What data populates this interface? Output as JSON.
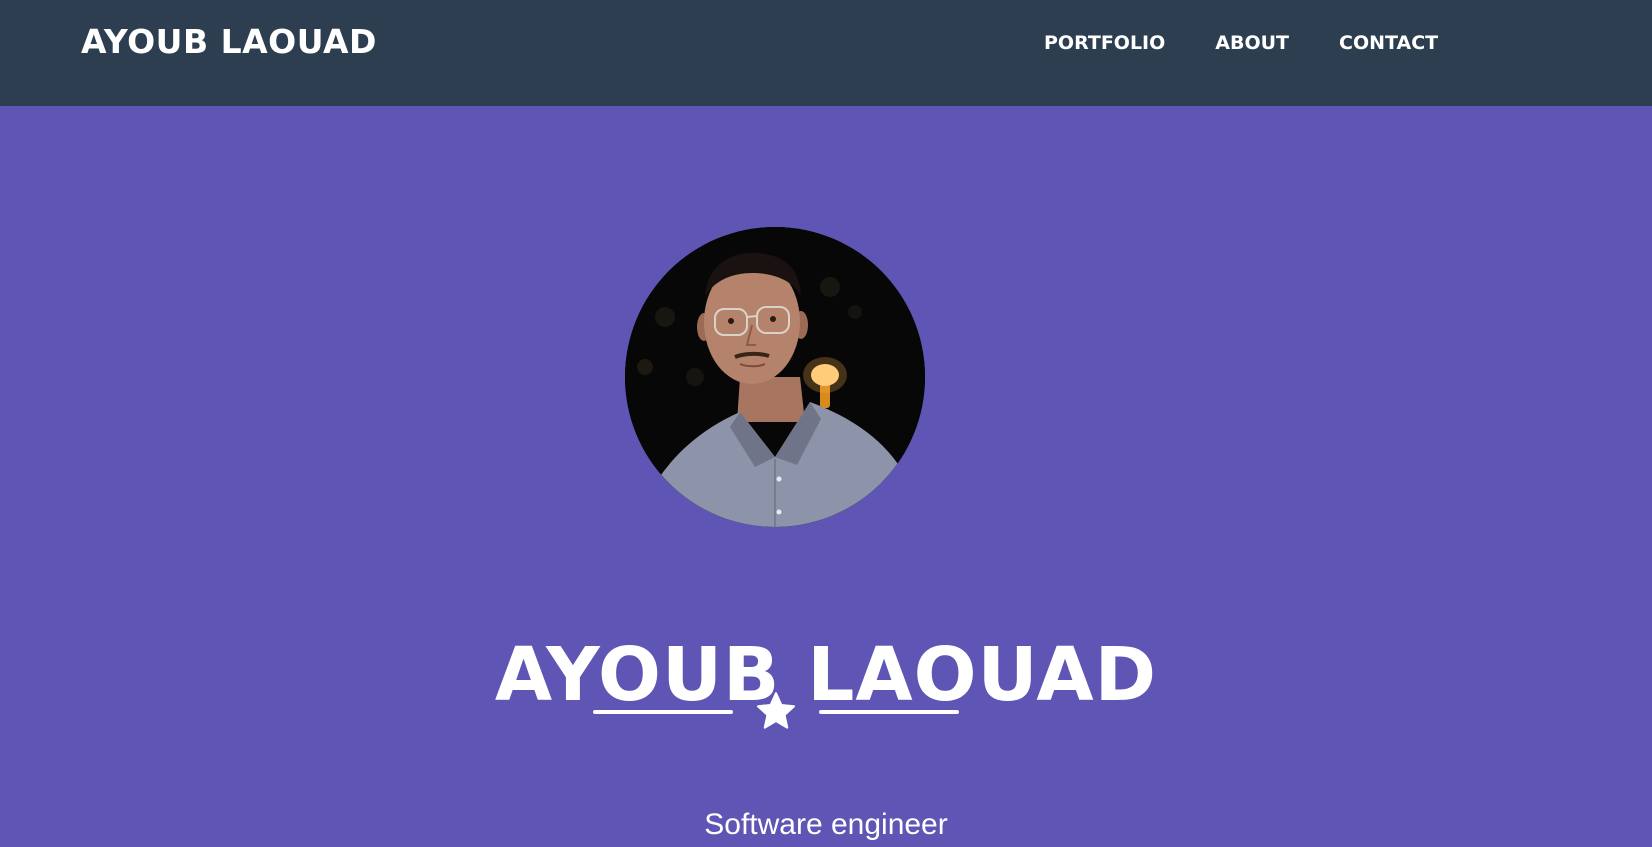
{
  "navbar": {
    "brand": "AYOUB LAOUAD",
    "links": [
      {
        "label": "PORTFOLIO"
      },
      {
        "label": "ABOUT"
      },
      {
        "label": "CONTACT"
      }
    ]
  },
  "hero": {
    "title": "AYOUB LAOUAD",
    "subtitle": "Software engineer",
    "divider_icon": "star-icon",
    "avatar_alt": "profile photo"
  },
  "colors": {
    "navbar_bg": "#2d3e50",
    "hero_bg": "#5e55b4",
    "text": "#ffffff"
  }
}
